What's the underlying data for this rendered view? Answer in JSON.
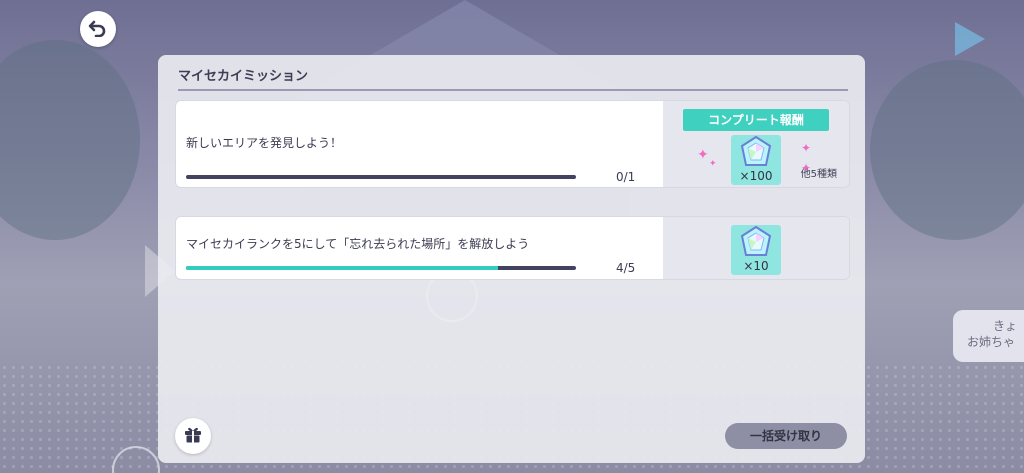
{
  "panel": {
    "title": "マイセカイミッション"
  },
  "missions": [
    {
      "text": "新しいエリアを発見しよう！",
      "progress_text": "0/1",
      "progress": 0.0,
      "reward": {
        "ribbon": "コンプリート報酬",
        "quantity": "×100",
        "other": "他5種類",
        "icon": "crystal-gem-icon"
      }
    },
    {
      "text": "マイセカイランクを5にして「忘れ去られた場所」を解放しよう",
      "progress_text": "4/5",
      "progress": 0.8,
      "reward": {
        "quantity": "×10",
        "icon": "crystal-gem-icon"
      }
    }
  ],
  "buttons": {
    "claim_all": "一括受け取り"
  },
  "side_bubble": {
    "line1": "きょ",
    "line2": "お姉ちゃ"
  },
  "colors": {
    "progress_fill": "#33cdbf",
    "progress_track": "#434360",
    "ribbon": "#3fd0c0",
    "gem_box": "#8fe6e0",
    "sparkle": "#f06cc4"
  }
}
